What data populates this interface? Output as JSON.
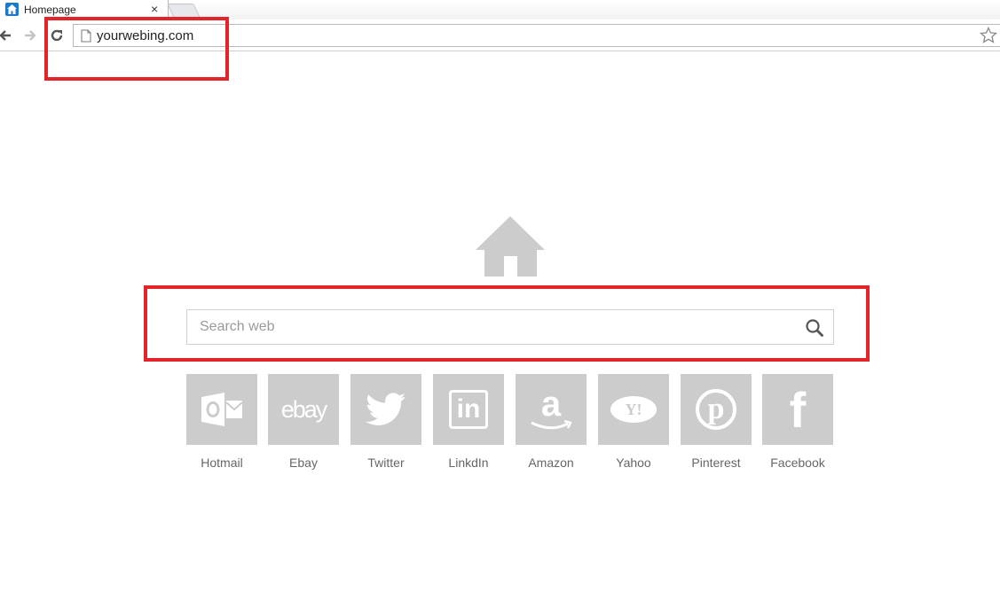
{
  "browser": {
    "tab_title": "Homepage",
    "tab_close": "×",
    "url": "yourwebing.com"
  },
  "colors": {
    "highlight": "#e3242b",
    "tile": "#cccccc",
    "label": "#666666",
    "favicon": "#1b79c8"
  },
  "search": {
    "placeholder": "Search web"
  },
  "shortcuts": [
    {
      "label": "Hotmail",
      "icon": "outlook-icon"
    },
    {
      "label": "Ebay",
      "icon": "ebay-icon"
    },
    {
      "label": "Twitter",
      "icon": "twitter-icon"
    },
    {
      "label": "LinkdIn",
      "icon": "linkedin-icon"
    },
    {
      "label": "Amazon",
      "icon": "amazon-icon"
    },
    {
      "label": "Yahoo",
      "icon": "yahoo-icon"
    },
    {
      "label": "Pinterest",
      "icon": "pinterest-icon"
    },
    {
      "label": "Facebook",
      "icon": "facebook-icon"
    }
  ],
  "tile_glyphs": {
    "ebay": "ebay",
    "linkedin": "in",
    "amazon": "a",
    "yahoo": "Y!",
    "pinterest": "p",
    "facebook": "f"
  }
}
